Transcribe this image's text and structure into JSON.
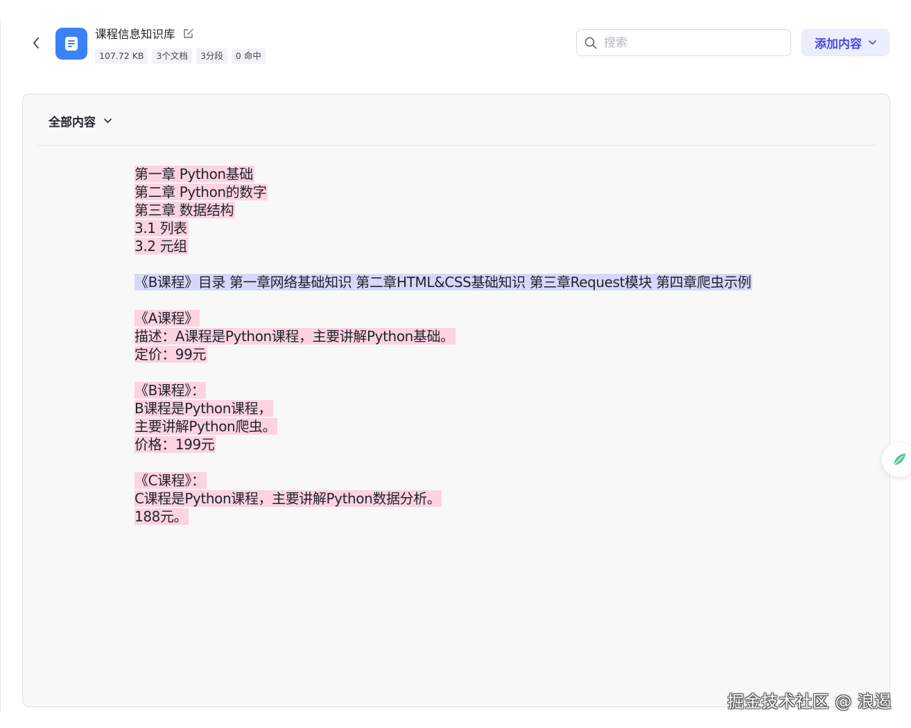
{
  "header": {
    "kb_name": "课程信息知识库",
    "meta": [
      "107.72 KB",
      "3个文档",
      "3分段",
      "0 命中"
    ],
    "search_placeholder": "搜索",
    "add_button_label": "添加内容"
  },
  "content": {
    "filter_label": "全部内容",
    "chunks": [
      {
        "style": "pink",
        "lines": [
          "第一章 Python基础",
          "第二章 Python的数字",
          "第三章 数据结构",
          "3.1 列表",
          "3.2 元组"
        ]
      },
      {
        "style": "blue",
        "lines": [
          "《B课程》目录 第一章网络基础知识 第二章HTML&CSS基础知识 第三章Request模块 第四章爬虫示例"
        ]
      },
      {
        "style": "pink",
        "lines": [
          "《A课程》",
          "描述：A课程是Python课程，主要讲解Python基础。",
          "定价：99元"
        ]
      },
      {
        "style": "pink",
        "lines": [
          "《B课程》：",
          "B课程是Python课程，",
          "主要讲解Python爬虫。",
          "价格：199元"
        ]
      },
      {
        "style": "pink",
        "lines": [
          "《C课程》：",
          "C课程是Python课程，主要讲解Python数据分析。",
          "188元。"
        ]
      }
    ]
  },
  "watermark": "掘金技术社区 @ 浪遏",
  "colors": {
    "accent": "#4f46e5",
    "kb_icon": "#3b82f6",
    "highlight_pink": "#fbd3e1",
    "highlight_blue": "#d6d8f8"
  },
  "icons": {
    "back": "chevron-left-icon",
    "kb": "document-icon",
    "edit": "edit-icon",
    "search": "search-icon",
    "dropdown": "chevron-down-icon",
    "assistant": "leaf-icon"
  }
}
